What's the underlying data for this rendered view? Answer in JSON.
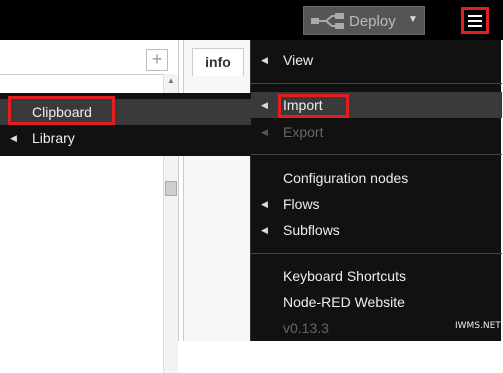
{
  "header": {
    "deploy_label": "Deploy",
    "deploy_caret": "▼",
    "deploy_icon": "deploy-flow-icon",
    "menu_icon": "hamburger-menu-icon"
  },
  "workspace": {
    "add_tab_label": "+"
  },
  "sidebar": {
    "active_tab": "info"
  },
  "main_menu": {
    "items": [
      {
        "label": "View",
        "submenu": true,
        "enabled": true
      },
      {
        "label": "Import",
        "submenu": true,
        "enabled": true,
        "active": true
      },
      {
        "label": "Export",
        "submenu": true,
        "enabled": false
      },
      {
        "label": "Configuration nodes",
        "submenu": false,
        "enabled": true
      },
      {
        "label": "Flows",
        "submenu": true,
        "enabled": true
      },
      {
        "label": "Subflows",
        "submenu": true,
        "enabled": true
      },
      {
        "label": "Keyboard Shortcuts",
        "submenu": false,
        "enabled": true
      },
      {
        "label": "Node-RED Website",
        "submenu": false,
        "enabled": true
      },
      {
        "label": "v0.13.3",
        "submenu": false,
        "enabled": false
      }
    ]
  },
  "import_submenu": {
    "items": [
      {
        "label": "Clipboard",
        "active": true
      },
      {
        "label": "Library",
        "submenu": true
      }
    ]
  },
  "highlight_color": "#e02020",
  "watermark": "IWMS.NET"
}
